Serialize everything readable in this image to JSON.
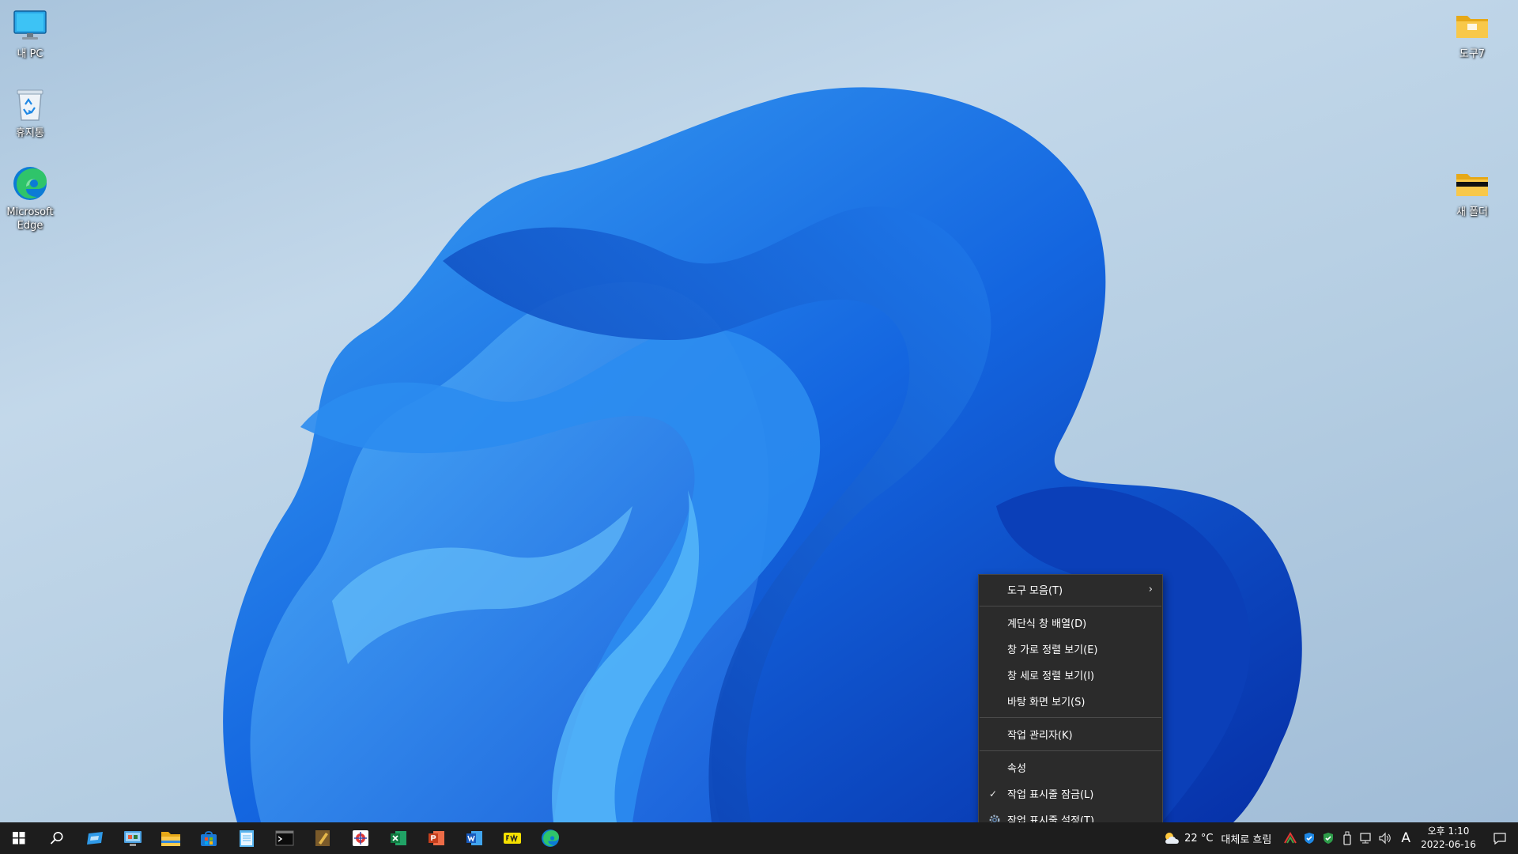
{
  "desktop": {
    "icons_left": [
      {
        "label": "내 PC",
        "icon": "monitor-icon"
      },
      {
        "label": "휴지통",
        "icon": "recycle-bin-icon"
      },
      {
        "label": "Microsoft Edge",
        "icon": "edge-icon"
      }
    ],
    "icons_right": [
      {
        "label": "도구7",
        "icon": "folder-icon"
      },
      {
        "label": "새 폴더",
        "icon": "folder-icon"
      }
    ]
  },
  "context_menu": {
    "items": [
      {
        "label": "도구 모음(T)",
        "has_submenu": true
      },
      {
        "label": "계단식 창 배열(D)"
      },
      {
        "label": "창 가로 정렬 보기(E)"
      },
      {
        "label": "창 세로 정렬 보기(I)"
      },
      {
        "label": "바탕 화면 보기(S)"
      },
      {
        "label": "작업 관리자(K)"
      },
      {
        "label": "속성"
      },
      {
        "label": "작업 표시줄 잠금(L)",
        "checked": true
      },
      {
        "label": "작업 표시줄 설정(T)",
        "icon": "gear-icon"
      }
    ],
    "check_glyph": "✓",
    "submenu_glyph": "›"
  },
  "taskbar": {
    "pinned": [
      "start-icon",
      "search-icon",
      "remote-desktop-icon",
      "control-panel-icon",
      "file-explorer-icon",
      "store-icon",
      "notepad-icon",
      "terminal-icon",
      "notes-app-icon",
      "snipping-app-icon",
      "excel-icon",
      "powerpoint-icon",
      "word-icon",
      "yellow-app-icon",
      "edge-icon"
    ],
    "weather": {
      "temp": "22 °C",
      "desc": "대체로 흐림"
    },
    "ime": "A",
    "clock": {
      "time": "오후 1:10",
      "date": "2022-06-16"
    }
  },
  "colors": {
    "taskbar_bg": "#1d1d1d",
    "menu_bg": "#2b2b2b",
    "wallpaper_blue": "#0a5bd6"
  }
}
